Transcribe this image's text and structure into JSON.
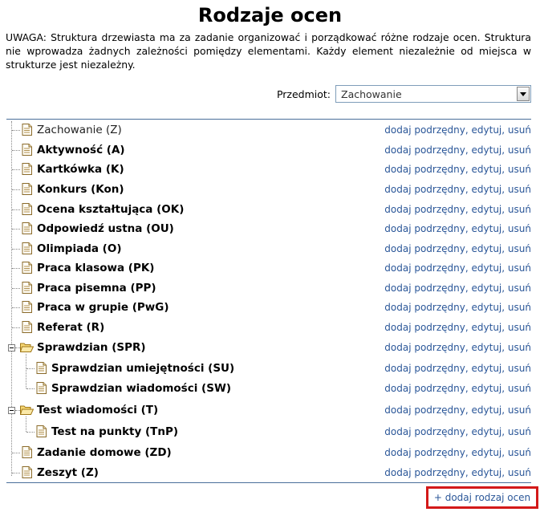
{
  "page": {
    "title": "Rodzaje ocen",
    "notice": "UWAGA: Struktura drzewiasta ma za zadanie organizować i porządkować różne rodzaje ocen. Struktura nie wprowadza żadnych zależności pomiędzy elementami. Każdy element niezależnie od miejsca w strukturze jest niezależny."
  },
  "subject": {
    "label": "Przedmiot:",
    "selected": "Zachowanie"
  },
  "tree": {
    "items": [
      {
        "label": "Zachowanie (Z)",
        "level": 0,
        "icon": "document-icon",
        "bold": false
      },
      {
        "label": "Aktywność (A)",
        "level": 1,
        "icon": "document-icon",
        "bold": true
      },
      {
        "label": "Kartkówka (K)",
        "level": 1,
        "icon": "document-icon",
        "bold": true
      },
      {
        "label": "Konkurs (Kon)",
        "level": 1,
        "icon": "document-icon",
        "bold": true
      },
      {
        "label": "Ocena kształtująca (OK)",
        "level": 1,
        "icon": "document-icon",
        "bold": true
      },
      {
        "label": "Odpowiedź ustna (OU)",
        "level": 1,
        "icon": "document-icon",
        "bold": true
      },
      {
        "label": "Olimpiada (O)",
        "level": 1,
        "icon": "document-icon",
        "bold": true
      },
      {
        "label": "Praca klasowa (PK)",
        "level": 1,
        "icon": "document-icon",
        "bold": true
      },
      {
        "label": "Praca pisemna (PP)",
        "level": 1,
        "icon": "document-icon",
        "bold": true
      },
      {
        "label": "Praca w grupie (PwG)",
        "level": 1,
        "icon": "document-icon",
        "bold": true
      },
      {
        "label": "Referat (R)",
        "level": 1,
        "icon": "document-icon",
        "bold": true
      },
      {
        "label": "Sprawdzian (SPR)",
        "level": 1,
        "icon": "folder-open-icon",
        "bold": true,
        "expanded": true
      },
      {
        "label": "Sprawdzian umiejętności (SU)",
        "level": 2,
        "icon": "document-icon",
        "bold": true
      },
      {
        "label": "Sprawdzian wiadomości (SW)",
        "level": 2,
        "icon": "document-icon",
        "bold": true
      },
      {
        "label": "Test wiadomości (T)",
        "level": 1,
        "icon": "folder-open-icon",
        "bold": true,
        "expanded": true
      },
      {
        "label": "Test na punkty (TnP)",
        "level": 2,
        "icon": "document-icon",
        "bold": true
      },
      {
        "label": "Zadanie domowe (ZD)",
        "level": 1,
        "icon": "document-icon",
        "bold": true
      },
      {
        "label": "Zeszyt (Z)",
        "level": 1,
        "icon": "document-icon",
        "bold": true
      }
    ]
  },
  "actions": {
    "add_child": "dodaj podrzędny",
    "edit": "edytuj",
    "delete": "usuń",
    "separator": ","
  },
  "footer": {
    "add_type": "+ dodaj rodzaj ocen"
  },
  "colors": {
    "link": "#2a5698",
    "highlight": "#d31919",
    "rule": "#4a6f9a"
  }
}
